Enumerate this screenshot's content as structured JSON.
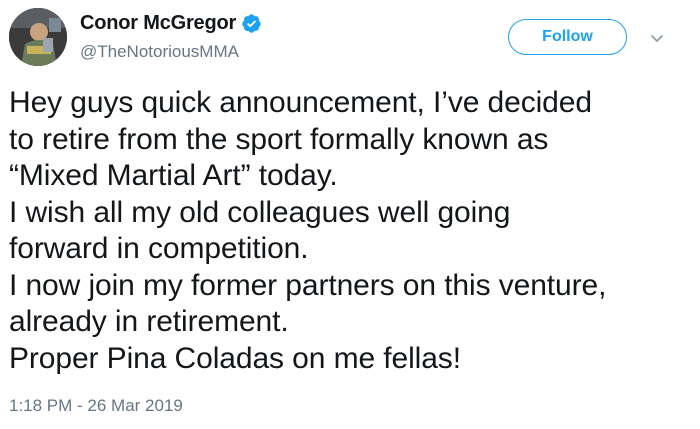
{
  "author": {
    "display_name": "Conor McGregor",
    "handle": "@TheNotoriousMMA",
    "verified": true,
    "avatar_icon": "profile-photo"
  },
  "follow_button": {
    "label": "Follow"
  },
  "menu": {
    "icon": "chevron-down-icon"
  },
  "tweet": {
    "lines": [
      "Hey guys quick announcement, I’ve decided",
      "to retire from the sport formally known as",
      "“Mixed Martial Art” today.",
      "I wish all my old colleagues well going",
      "forward in competition.",
      "I now join my former partners on this venture,",
      "already in retirement.",
      "Proper Pina Coladas on me fellas!"
    ],
    "timestamp": "1:18 PM - 26 Mar 2019"
  },
  "colors": {
    "accent": "#1da1f2",
    "text": "#14171a",
    "secondary_text": "#657786"
  }
}
